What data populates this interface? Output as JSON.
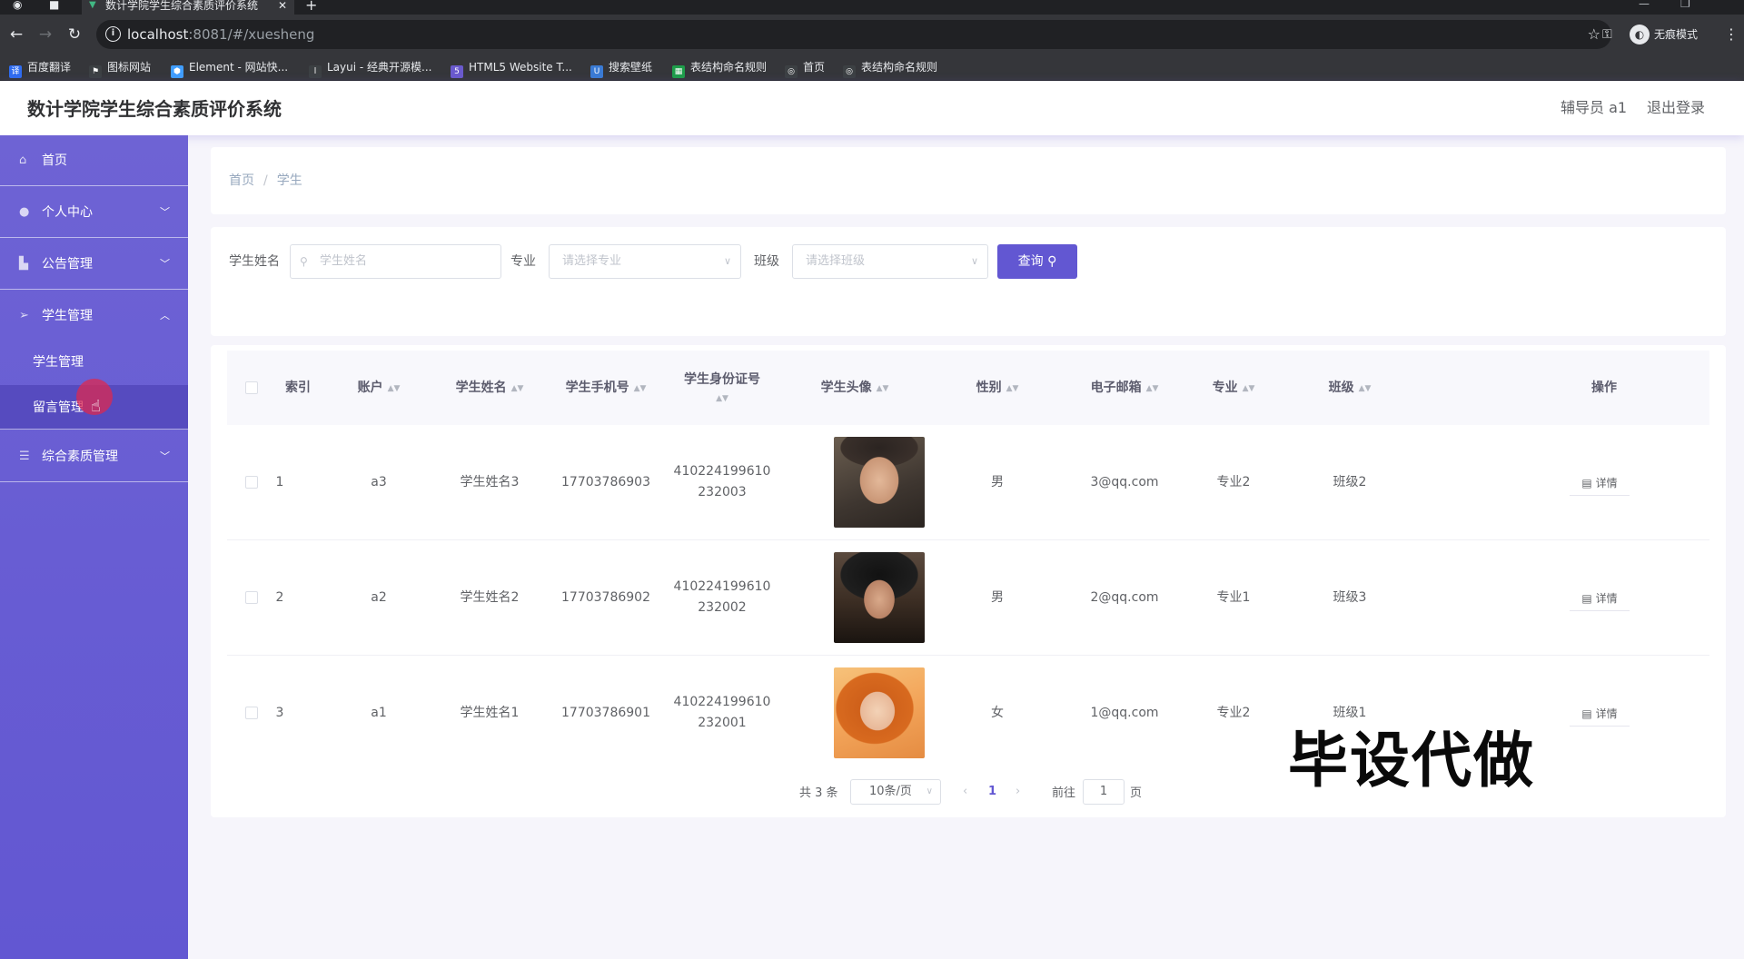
{
  "browser": {
    "tab_title": "数计学院学生综合素质评价系统",
    "url_host": "localhost",
    "url_rest": ":8081/#/xuesheng",
    "incognito_label": "无痕模式",
    "bookmarks": [
      {
        "label": "百度翻译",
        "icon": "baidu-translate-icon",
        "color": "#2f6cf0"
      },
      {
        "label": "图标网站",
        "icon": "flag-icon",
        "color": "#3c4043"
      },
      {
        "label": "Element - 网站快...",
        "icon": "element-icon",
        "color": "#409eff"
      },
      {
        "label": "Layui - 经典开源模...",
        "icon": "layui-icon",
        "color": "#3c4043"
      },
      {
        "label": "HTML5 Website T...",
        "icon": "html5-icon",
        "color": "#6a5acd"
      },
      {
        "label": "搜索壁纸",
        "icon": "wallpaper-icon",
        "color": "#3a7bd5"
      },
      {
        "label": "表结构命名规则",
        "icon": "sheet-icon",
        "color": "#1e9e4a"
      },
      {
        "label": "首页",
        "icon": "globe-icon",
        "color": "#3c4043"
      },
      {
        "label": "表结构命名规则",
        "icon": "globe-icon",
        "color": "#3c4043"
      }
    ]
  },
  "header": {
    "title": "数计学院学生综合素质评价系统",
    "user": "辅导员 a1",
    "logout": "退出登录"
  },
  "sidebar": {
    "items": [
      {
        "label": "首页",
        "icon": "home-icon"
      },
      {
        "label": "个人中心",
        "icon": "user-icon",
        "arrow": "chevron-down"
      },
      {
        "label": "公告管理",
        "icon": "chart-icon",
        "arrow": "chevron-down"
      },
      {
        "label": "学生管理",
        "icon": "send-icon",
        "arrow": "chevron-up"
      },
      {
        "label": "综合素质管理",
        "icon": "list-icon",
        "arrow": "chevron-down"
      }
    ],
    "subitems": [
      {
        "label": "学生管理"
      },
      {
        "label": "留言管理"
      }
    ]
  },
  "breadcrumb": {
    "home": "首页",
    "current": "学生"
  },
  "search": {
    "name_label": "学生姓名",
    "name_placeholder": "学生姓名",
    "major_label": "专业",
    "major_placeholder": "请选择专业",
    "class_label": "班级",
    "class_placeholder": "请选择班级",
    "button": "查询"
  },
  "table": {
    "columns": [
      "索引",
      "账户",
      "学生姓名",
      "学生手机号",
      "学生身份证号",
      "学生头像",
      "性别",
      "电子邮箱",
      "专业",
      "班级",
      "操作"
    ],
    "rows": [
      {
        "index": "1",
        "account": "a3",
        "name": "学生姓名3",
        "phone": "17703786903",
        "id1": "410224199610",
        "id2": "232003",
        "gender": "男",
        "email": "3@qq.com",
        "major": "专业2",
        "class": "班级2",
        "action": "详情"
      },
      {
        "index": "2",
        "account": "a2",
        "name": "学生姓名2",
        "phone": "17703786902",
        "id1": "410224199610",
        "id2": "232002",
        "gender": "男",
        "email": "2@qq.com",
        "major": "专业1",
        "class": "班级3",
        "action": "详情"
      },
      {
        "index": "3",
        "account": "a1",
        "name": "学生姓名1",
        "phone": "17703786901",
        "id1": "410224199610",
        "id2": "232001",
        "gender": "女",
        "email": "1@qq.com",
        "major": "专业2",
        "class": "班级1",
        "action": "详情"
      }
    ]
  },
  "pagination": {
    "total": "共 3 条",
    "page_size": "10条/页",
    "current_page": "1",
    "goto_label": "前往",
    "goto_value": "1",
    "page_unit": "页"
  },
  "watermark": "毕设代做",
  "colors": {
    "accent": "#6257d2",
    "sidebar": "#6e63d4",
    "active_sub": "#564bbf",
    "page_link": "#6257d2"
  }
}
